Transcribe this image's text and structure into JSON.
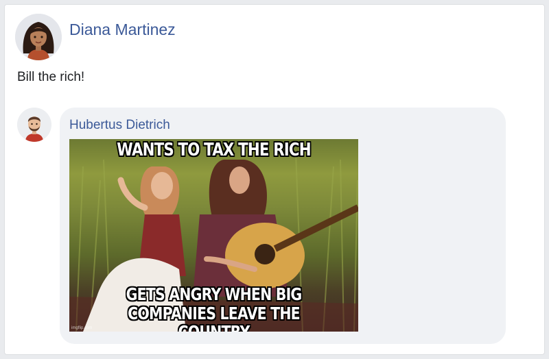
{
  "post": {
    "author": "Diana Martinez",
    "text": "Bill the rich!"
  },
  "comment": {
    "author": "Hubertus Dietrich",
    "meme": {
      "top_text": "WANTS TO TAX THE RICH",
      "bottom_text_line1": "GETS ANGRY WHEN BIG",
      "bottom_text_line2": "COMPANIES LEAVE THE COUNTRY",
      "watermark": "imgflip.com"
    }
  },
  "colors": {
    "background": "#e9ebee",
    "link": "#3b5998",
    "bubble": "#f0f2f5"
  }
}
